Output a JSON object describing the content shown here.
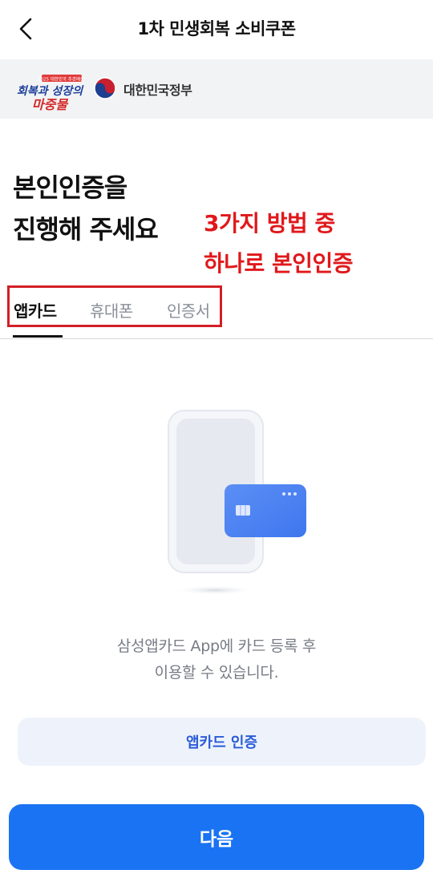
{
  "header": {
    "title": "1차 민생회복 소비쿠폰",
    "back_icon": "chevron-left-icon"
  },
  "banner": {
    "campaign_logo_lines": [
      "2025 대한민국 추경예산",
      "회복과 성장의",
      "마중물"
    ],
    "gov_emblem_icon": "taegeuk-emblem-icon",
    "gov_name": "대한민국정부"
  },
  "main": {
    "headline_line1": "본인인증을",
    "headline_line2": "진행해 주세요",
    "annotation_line1": "3가지 방법 중",
    "annotation_line2": "하나로 본인인증",
    "tabs": [
      {
        "label": "앱카드",
        "active": true
      },
      {
        "label": "휴대폰",
        "active": false
      },
      {
        "label": "인증서",
        "active": false
      }
    ],
    "illustration_icon": "phone-with-card-icon",
    "description_line1": "삼성앱카드 App에 카드 등록 후",
    "description_line2": "이용할 수 있습니다."
  },
  "buttons": {
    "appcard_auth": "앱카드 인증",
    "next": "다음"
  },
  "colors": {
    "annotation_red": "#e0181b",
    "primary_blue": "#1a73f2",
    "secondary_bg": "#eef3fb",
    "secondary_text": "#2a5bd7",
    "banner_bg": "#f2f3f5"
  }
}
